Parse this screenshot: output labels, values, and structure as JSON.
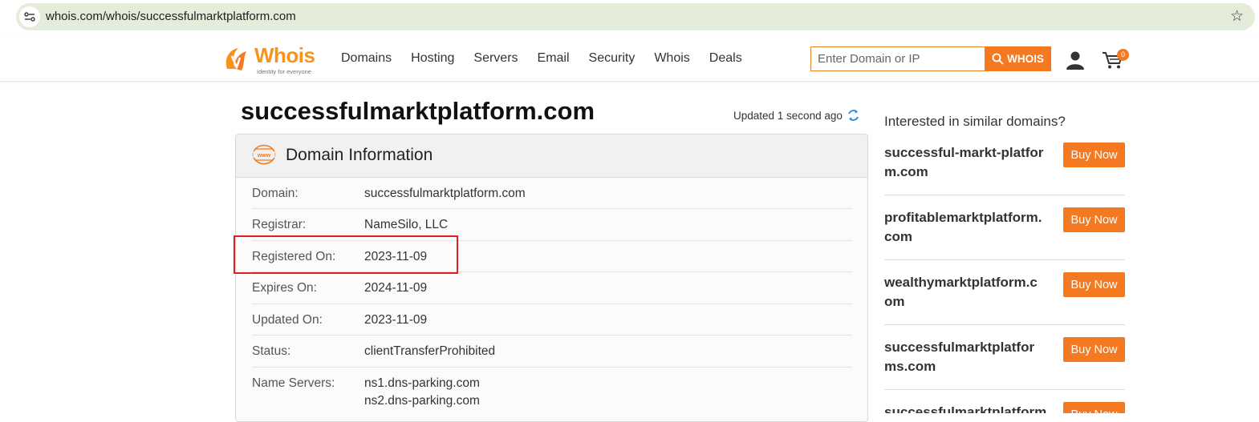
{
  "browser": {
    "url": "whois.com/whois/successfulmarktplatform.com"
  },
  "header": {
    "logo_word": "Whois",
    "logo_tagline": "Identity for everyone",
    "nav": [
      "Domains",
      "Hosting",
      "Servers",
      "Email",
      "Security",
      "Whois",
      "Deals"
    ],
    "search_placeholder": "Enter Domain or IP",
    "search_button": "WHOIS",
    "cart_count": "0"
  },
  "main": {
    "domain_title": "successfulmarktplatform.com",
    "updated_text": "Updated 1 second ago",
    "card_title": "Domain Information",
    "rows": [
      {
        "label": "Domain:",
        "value": "successfulmarktplatform.com"
      },
      {
        "label": "Registrar:",
        "value": "NameSilo, LLC"
      },
      {
        "label": "Registered On:",
        "value": "2023-11-09"
      },
      {
        "label": "Expires On:",
        "value": "2024-11-09"
      },
      {
        "label": "Updated On:",
        "value": "2023-11-09"
      },
      {
        "label": "Status:",
        "value": "clientTransferProhibited"
      },
      {
        "label": "Name Servers:",
        "value": "ns1.dns-parking.com",
        "value2": "ns2.dns-parking.com"
      }
    ]
  },
  "sidebar": {
    "heading": "Interested in similar domains?",
    "buy_label": "Buy Now",
    "suggestions": [
      "successful-markt-platform.com",
      "profitablemarktplatform.com",
      "wealthymarktplatform.com",
      "successfulmarktplatforms.com",
      "successfulmarktplatform"
    ]
  },
  "colors": {
    "accent": "#f47920",
    "highlight": "#e02020"
  }
}
